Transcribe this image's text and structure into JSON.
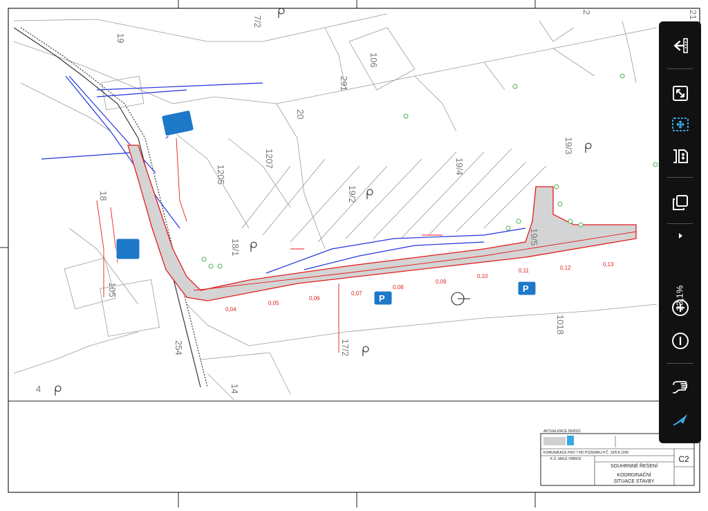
{
  "drawing": {
    "parcels": [
      "19",
      "7/2",
      "2",
      "106",
      "291",
      "20",
      "1207",
      "1205",
      "19/4",
      "19/3",
      "19/2",
      "18/1",
      "18",
      "105",
      "19/5",
      "1018",
      "254",
      "14",
      "4",
      "17/2",
      "21"
    ],
    "chainage": [
      "0,04",
      "0,05",
      "0,06",
      "0,07",
      "0,08",
      "0,09",
      "0,10",
      "0,11",
      "0,12",
      "0,13"
    ]
  },
  "title_block": {
    "update": "AKTUALIZACE 09/2022",
    "project": "KOMUNIKACE PRO 7 RD POZEMKU P.Č. 19/5 A 1206",
    "site": "K.Ú. MALÉ VRBICE",
    "section": "SOUHRNNÉ ŘEŠENÍ",
    "sheet_title_1": "KOORDINAČNÍ",
    "sheet_title_2": "SITUACE STAVBY",
    "sheet_no": "C2"
  },
  "toolbar": {
    "zoom_level": "23,1%",
    "icons": [
      "collapse-panel-icon",
      "fit-page-icon",
      "fit-width-icon",
      "fit-height-icon",
      "pages-icon",
      "expand-arrow-icon",
      "zoom-in-icon",
      "zoom-out-icon",
      "pan-hand-icon",
      "annotate-arrow-icon"
    ],
    "accent": "#3aa7e0"
  }
}
